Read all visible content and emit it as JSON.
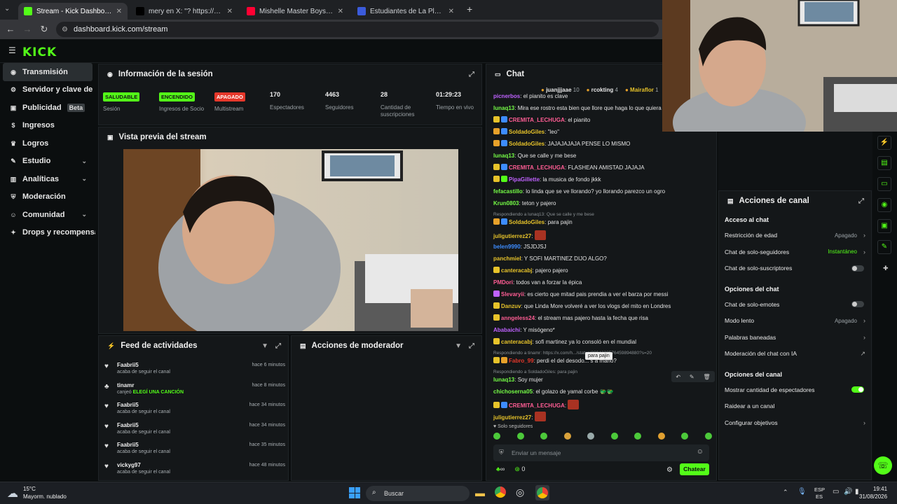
{
  "browser": {
    "tabs": [
      {
        "title": "Stream - Kick Dashboard",
        "color": "#53fc18",
        "active": true
      },
      {
        "title": "mery en X: \"? https://t.co/4GO",
        "color": "#000000",
        "active": false
      },
      {
        "title": "Mishelle Master Boys Ft. Jd La C",
        "color": "#ff0033",
        "active": false
      },
      {
        "title": "Estudiantes de La Plata vs. New",
        "color": "#3b5bdb",
        "active": false
      }
    ],
    "url": "dashboard.kick.com/stream"
  },
  "brand": {
    "logo": "KICK",
    "accent": "#53fc18"
  },
  "sidebar": {
    "items": [
      {
        "label": "Transmisión",
        "icon": "broadcast-icon",
        "glyph": "◉",
        "active": true
      },
      {
        "label": "Servidor y clave de retransmisión",
        "icon": "server-key-icon",
        "glyph": "⚙"
      },
      {
        "label": "Publicidad",
        "icon": "megaphone-icon",
        "glyph": "▣",
        "badge": "Beta"
      },
      {
        "label": "Ingresos",
        "icon": "money-icon",
        "glyph": "$"
      },
      {
        "label": "Logros",
        "icon": "trophy-icon",
        "glyph": "♛"
      },
      {
        "label": "Estudio",
        "icon": "studio-icon",
        "glyph": "✎",
        "expand": true
      },
      {
        "label": "Analíticas",
        "icon": "analytics-icon",
        "glyph": "▥",
        "expand": true
      },
      {
        "label": "Moderación",
        "icon": "shield-icon",
        "glyph": "⛨"
      },
      {
        "label": "Comunidad",
        "icon": "community-icon",
        "glyph": "☺",
        "expand": true
      },
      {
        "label": "Drops y recompensas",
        "icon": "gift-icon",
        "glyph": "✦"
      }
    ]
  },
  "session": {
    "title": "Información de la sesión",
    "stats": [
      {
        "badge": "SALUDABLE",
        "badge_color": "#53fc18",
        "label": "Sesión"
      },
      {
        "badge": "ENCENDIDO",
        "badge_color": "#53fc18",
        "label": "Ingresos de Socio"
      },
      {
        "badge": "APAGADO",
        "badge_color": "#e5372a",
        "label": "Multistream"
      },
      {
        "value": "170",
        "label": "Espectadores"
      },
      {
        "value": "4463",
        "label": "Seguidores"
      },
      {
        "value": "28",
        "label": "Cantidad de suscripciones"
      },
      {
        "value": "01:29:23",
        "label": "Tiempo en vivo"
      }
    ]
  },
  "preview": {
    "title": "Vista previa del stream"
  },
  "activity": {
    "title": "Feed de actividades",
    "items": [
      {
        "name": "Faabrii5",
        "text": "acaba de seguir el canal",
        "time": "hace 6 minutos",
        "icon": "heart-icon"
      },
      {
        "name": "tinamr",
        "text": "canjeó",
        "reward": "ELEGÍ UNA CANCIÓN",
        "time": "hace 8 minutos",
        "icon": "reward-icon"
      },
      {
        "name": "Faabrii5",
        "text": "acaba de seguir el canal",
        "time": "hace 34 minutos",
        "icon": "heart-icon"
      },
      {
        "name": "Faabrii5",
        "text": "acaba de seguir el canal",
        "time": "hace 34 minutos",
        "icon": "heart-icon"
      },
      {
        "name": "Faabrii5",
        "text": "acaba de seguir el canal",
        "time": "hace 35 minutos",
        "icon": "heart-icon"
      },
      {
        "name": "vickyg97",
        "text": "acaba de seguir el canal",
        "time": "hace 48 minutos",
        "icon": "heart-icon"
      }
    ]
  },
  "moderator": {
    "title": "Acciones de moderador"
  },
  "chat": {
    "title": "Chat",
    "top_gifters": [
      {
        "name": "juanjjjaae",
        "count": "10"
      },
      {
        "name": "rcokting",
        "count": "4"
      },
      {
        "name": "Mairaflor",
        "count": "1"
      }
    ],
    "messages": [
      {
        "user": "picnerbos",
        "color": "#bf62ff",
        "text": "el pianito es clave"
      },
      {
        "user": "lunaq13",
        "color": "#75fd46",
        "text": "Mira ese rostro esta bien que llore que haga lo que quiera"
      },
      {
        "user": "CREMITA_LECHUGA",
        "color": "#ff5d94",
        "text": "el pianito",
        "badges": [
          "#e7c32a",
          "#3d8cff"
        ]
      },
      {
        "user": "SoldadoGiles",
        "color": "#e7c32a",
        "text": "\"leo\"",
        "badges": [
          "#e7a12a",
          "#3d8cff"
        ]
      },
      {
        "user": "SoldadoGiles",
        "color": "#e7c32a",
        "text": "JAJAJAJAJA PENSE LO MISMO",
        "badges": [
          "#e7a12a",
          "#3d8cff"
        ]
      },
      {
        "user": "lunaq13",
        "color": "#75fd46",
        "text": "Que se calle y me bese"
      },
      {
        "user": "CREMITA_LECHUGA",
        "color": "#ff5d94",
        "text": "FLASHEAN AMISTAD JAJAJA",
        "badges": [
          "#e7c32a",
          "#3d8cff"
        ]
      },
      {
        "user": "PipaGillette",
        "color": "#bf62ff",
        "text": "la musica de fondo jkkk",
        "badges": [
          "#e7c32a",
          "#53fc18"
        ]
      },
      {
        "user": "fefacastillo",
        "color": "#75fd46",
        "text": "lo linda que se ve llorando? yo llorando parezco un ogro"
      },
      {
        "user": "Krun0803",
        "color": "#75fd46",
        "text": "teton y pajero"
      },
      {
        "reply": "Respondiendo a lunaq13: Que se calle y me bese"
      },
      {
        "user": "SoldadoGiles",
        "color": "#e7c32a",
        "text": "para pajin",
        "badges": [
          "#e7a12a",
          "#3d8cff"
        ]
      },
      {
        "user": "juligutierrez27",
        "color": "#e7c32a",
        "text": "",
        "emote": true
      },
      {
        "user": "belen9990",
        "color": "#3d8cff",
        "text": "JSJDJSJ"
      },
      {
        "user": "panchmiel",
        "color": "#e7c32a",
        "text": "Y SOFI MARTINEZ DIJO ALGO?"
      },
      {
        "user": "canteracabj",
        "color": "#e7c32a",
        "text": "pajero pajero",
        "badges": [
          "#e7c32a"
        ]
      },
      {
        "user": "PMDori",
        "color": "#ff5d94",
        "text": "todos van a forzar la épica"
      },
      {
        "user": "Slevaryii",
        "color": "#ff5d94",
        "text": "es cierto que mitad pais prendia a ver el barza por messi",
        "badges": [
          "#bf62ff"
        ]
      },
      {
        "user": "Danzuv",
        "color": "#e7c32a",
        "text": "que Linda More volveré a ver los vlogs del mito en Londres",
        "badges": [
          "#e7c32a"
        ]
      },
      {
        "user": "anngeless24",
        "color": "#ff5d94",
        "text": "el stream mas pajero hasta la fecha que risa",
        "badges": [
          "#e7c32a"
        ]
      },
      {
        "user": "Ababaichi",
        "color": "#bf62ff",
        "text": "Y misógeno*"
      },
      {
        "user": "canteracabj",
        "color": "#e7c32a",
        "text": "sofi martinez ya lo consoló en el mundial",
        "badges": [
          "#e7c32a"
        ]
      },
      {
        "reply": "Respondiendo a tinamr: https://x.com/h.../status/2094233576459894880?s=20"
      },
      {
        "user": "Fabro_99",
        "color": "#e5372a",
        "text": "perdi el del desodo... s a mano?",
        "badges": [
          "#e7c32a",
          "#e7a12a"
        ]
      },
      {
        "reply": "Respondiendo a SoldadoGiles: para pajin"
      },
      {
        "user": "lunaq13",
        "color": "#75fd46",
        "text": "Soy mujer"
      },
      {
        "user": "chichoserna05",
        "color": "#75fd46",
        "text": "el golazo de yamal corbe 🐲🐲"
      },
      {
        "user": "CREMITA_LECHUGA",
        "color": "#ff5d94",
        "text": "",
        "emote": true,
        "badges": [
          "#e7c32a",
          "#3d8cff"
        ]
      },
      {
        "user": "juligutierrez27",
        "color": "#e7c32a",
        "text": "",
        "emote": true
      }
    ],
    "tooltip": "para pajin",
    "followers_only": "Solo seguidores",
    "input_placeholder": "Enviar un mensaje",
    "send_label": "Chatear",
    "points": "0",
    "infinity": "∞"
  },
  "channel_actions": {
    "title": "Acciones de canal",
    "sections": [
      {
        "title": "Acceso al chat",
        "items": [
          {
            "label": "Restricción de edad",
            "value": "Apagado",
            "kind": "arrow"
          },
          {
            "label": "Chat de solo-seguidores",
            "value": "Instantáneo",
            "value_color": "#53fc18",
            "kind": "arrow"
          },
          {
            "label": "Chat de solo-suscriptores",
            "kind": "toggle",
            "on": false
          }
        ]
      },
      {
        "title": "Opciones del chat",
        "items": [
          {
            "label": "Chat de solo-emotes",
            "kind": "toggle",
            "on": false
          },
          {
            "label": "Modo lento",
            "value": "Apagado",
            "kind": "arrow"
          },
          {
            "label": "Palabras baneadas",
            "kind": "arrow"
          },
          {
            "label": "Moderación del chat con IA",
            "kind": "external"
          }
        ]
      },
      {
        "title": "Opciones del canal",
        "items": [
          {
            "label": "Mostrar cantidad de espectadores",
            "kind": "toggle",
            "on": true
          },
          {
            "label": "Raidear a un canal",
            "kind": "none"
          },
          {
            "label": "Configurar objetivos",
            "kind": "arrow"
          }
        ]
      }
    ]
  },
  "taskbar": {
    "weather_temp": "15°C",
    "weather_desc": "Mayorm. nublado",
    "search": "Buscar",
    "lang1": "ESP",
    "lang2": "ES",
    "time": "19:41",
    "date": "31/08/2026"
  }
}
